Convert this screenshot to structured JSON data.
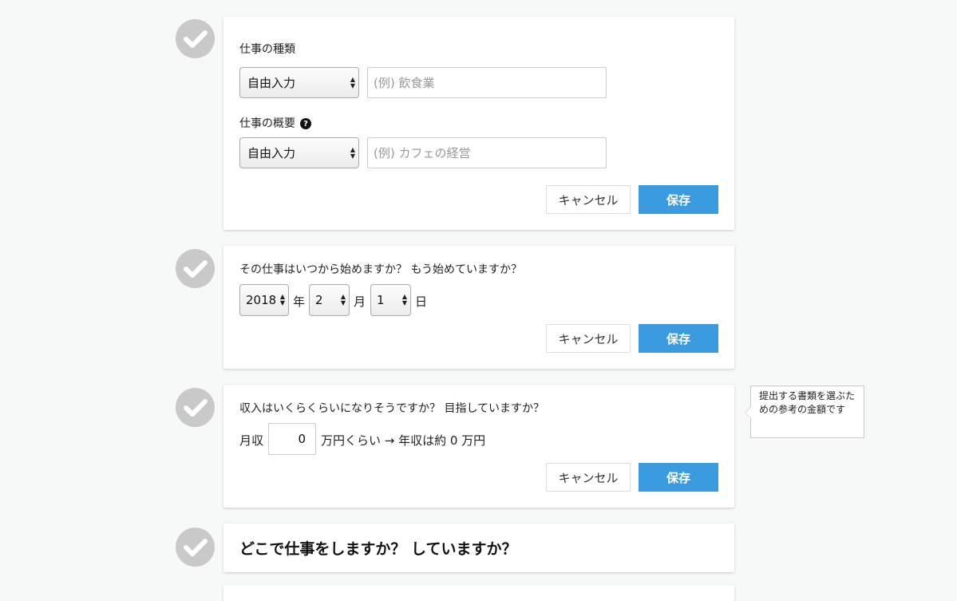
{
  "section1": {
    "job_type_label": "仕事の種類",
    "job_type_select": "自由入力",
    "job_type_placeholder": "(例) 飲食業",
    "job_summary_label": "仕事の概要",
    "help_icon_glyph": "?",
    "job_summary_select": "自由入力",
    "job_summary_placeholder": "(例) カフェの経営",
    "cancel_label": "キャンセル",
    "save_label": "保存"
  },
  "section2": {
    "question": "その仕事はいつから始めますか？ もう始めていますか？",
    "year_value": "2018",
    "year_unit": "年",
    "month_value": "2",
    "month_unit": "月",
    "day_value": "1",
    "day_unit": "日",
    "cancel_label": "キャンセル",
    "save_label": "保存"
  },
  "section3": {
    "question": "収入はいくらくらいになりそうですか？ 目指していますか？",
    "monthly_label": "月収",
    "monthly_value": "0",
    "result_text": "万円くらい → 年収は約 0 万円",
    "cancel_label": "キャンセル",
    "save_label": "保存",
    "tooltip": "提出する書類を選ぶための参考の金額です"
  },
  "section4": {
    "title": "どこで仕事をしますか？ していますか？"
  },
  "colors": {
    "primary": "#3a9be0",
    "check_circle": "#c9c9c9",
    "background": "#f7f8f8"
  },
  "icons": {
    "check": "check-icon",
    "help": "question-circle-icon",
    "select_arrows": "up-down-arrows-icon"
  }
}
